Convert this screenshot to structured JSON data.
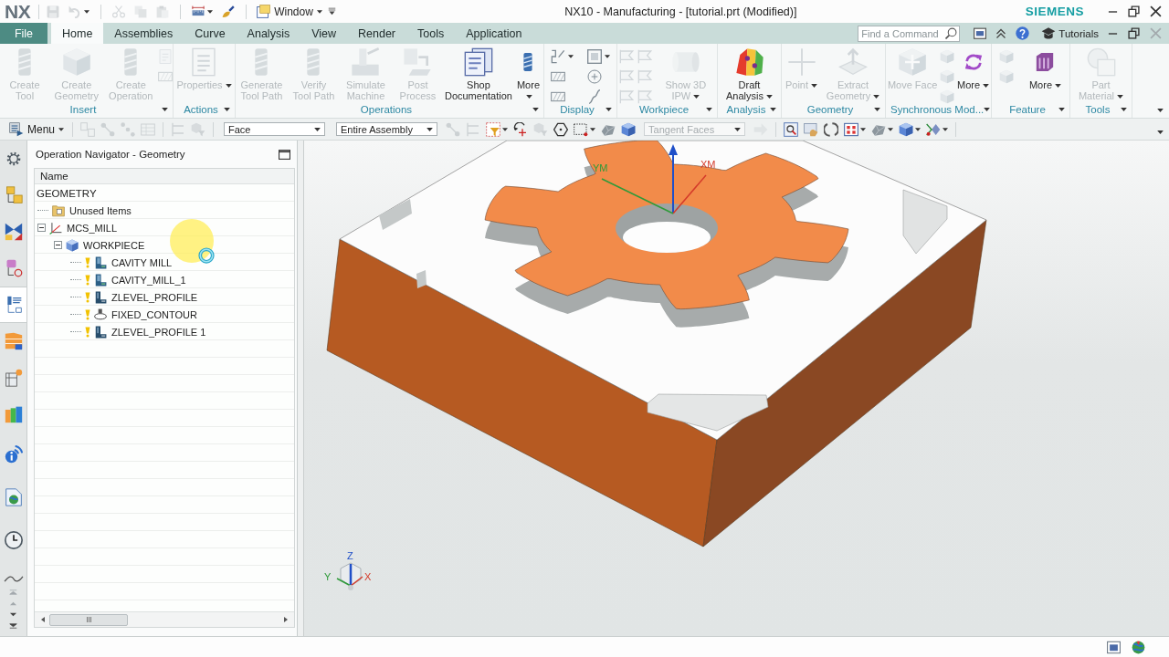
{
  "title_bar": {
    "logo": "NX",
    "quick_access": [
      {
        "disabled": true,
        "dropdown": false
      },
      {
        "disabled": true,
        "dropdown": true
      },
      {
        "disabled": true,
        "dropdown": false
      },
      {
        "disabled": true,
        "dropdown": false
      },
      {
        "disabled": true,
        "dropdown": false
      },
      {
        "disabled": false,
        "dropdown": true
      },
      {
        "disabled": false,
        "dropdown": false
      }
    ],
    "window_menu": "Window",
    "title": "NX10 - Manufacturing - [tutorial.prt (Modified)]",
    "brand": "SIEMENS"
  },
  "ribbon": {
    "tabs": [
      {
        "label": "File",
        "kind": "file",
        "selected": false
      },
      {
        "label": "Home",
        "kind": "tab",
        "selected": true
      },
      {
        "label": "Assemblies",
        "kind": "tab",
        "selected": false
      },
      {
        "label": "Curve",
        "kind": "tab",
        "selected": false
      },
      {
        "label": "Analysis",
        "kind": "tab",
        "selected": false
      },
      {
        "label": "View",
        "kind": "tab",
        "selected": false
      },
      {
        "label": "Render",
        "kind": "tab",
        "selected": false
      },
      {
        "label": "Tools",
        "kind": "tab",
        "selected": false
      },
      {
        "label": "Application",
        "kind": "tab",
        "selected": false
      }
    ],
    "search": {
      "placeholder": "Find a Command"
    },
    "help_link": "Tutorials",
    "groups": [
      {
        "label": "Insert",
        "commands": [
          {
            "kind": "large",
            "label": "Create Tool",
            "disabled": true,
            "dropdown": false
          },
          {
            "kind": "large",
            "label": "Create Geometry",
            "disabled": true,
            "dropdown": false
          },
          {
            "kind": "large",
            "label": "Create Operation",
            "disabled": true,
            "dropdown": false
          },
          {
            "kind": "stack",
            "items": [
              {
                "disabled": true,
                "dropdown": false
              },
              {
                "disabled": true,
                "dropdown": false
              }
            ]
          }
        ]
      },
      {
        "label": "Actions",
        "commands": [
          {
            "kind": "large",
            "label": "Properties",
            "disabled": true,
            "dropdown": true
          }
        ]
      },
      {
        "label": "Operations",
        "commands": [
          {
            "kind": "large",
            "label": "Generate Tool Path",
            "disabled": true,
            "dropdown": false
          },
          {
            "kind": "large",
            "label": "Verify Tool Path",
            "disabled": true,
            "dropdown": false
          },
          {
            "kind": "large",
            "label": "Simulate Machine",
            "disabled": true,
            "dropdown": false
          },
          {
            "kind": "large",
            "label": "Post Process",
            "disabled": true,
            "dropdown": false
          },
          {
            "kind": "large",
            "label": "Shop Documentation",
            "disabled": false,
            "dropdown": false
          },
          {
            "kind": "more",
            "label": "More",
            "disabled": false,
            "dropdown": true
          }
        ]
      },
      {
        "label": "Display",
        "commands": [
          {
            "kind": "stack",
            "items": [
              {
                "disabled": false,
                "dropdown": true
              },
              {
                "disabled": false,
                "dropdown": false
              },
              {
                "disabled": false,
                "dropdown": false
              }
            ]
          },
          {
            "kind": "stack",
            "items": [
              {
                "disabled": false,
                "dropdown": true
              },
              {
                "disabled": false,
                "dropdown": false
              },
              {
                "disabled": false,
                "dropdown": false
              }
            ]
          }
        ]
      },
      {
        "label": "Workpiece",
        "commands": [
          {
            "kind": "stack",
            "items": [
              {
                "disabled": true,
                "dropdown": false
              },
              {
                "disabled": true,
                "dropdown": false
              },
              {
                "disabled": true,
                "dropdown": false
              }
            ]
          },
          {
            "kind": "stack",
            "items": [
              {
                "disabled": true,
                "dropdown": false
              },
              {
                "disabled": true,
                "dropdown": false
              },
              {
                "disabled": true,
                "dropdown": false
              }
            ]
          },
          {
            "kind": "large",
            "label": "Show 3D IPW",
            "disabled": true,
            "dropdown": true
          }
        ]
      },
      {
        "label": "Analysis",
        "commands": [
          {
            "kind": "large",
            "label": "Draft Analysis",
            "disabled": false,
            "dropdown": true
          }
        ]
      },
      {
        "label": "Geometry",
        "commands": [
          {
            "kind": "large",
            "label": "Point",
            "disabled": true,
            "dropdown": true
          },
          {
            "kind": "large",
            "label": "Extract Geometry",
            "disabled": true,
            "dropdown": true
          }
        ]
      },
      {
        "label": "Synchronous Mod...",
        "commands": [
          {
            "kind": "large",
            "label": "Move Face",
            "disabled": true,
            "dropdown": false
          },
          {
            "kind": "stack",
            "items": [
              {
                "disabled": true,
                "dropdown": false
              },
              {
                "disabled": true,
                "dropdown": false
              },
              {
                "disabled": true,
                "dropdown": false
              }
            ]
          },
          {
            "kind": "more",
            "label": "More",
            "disabled": false,
            "dropdown": true
          }
        ]
      },
      {
        "label": "Feature",
        "commands": [
          {
            "kind": "stack",
            "items": [
              {
                "disabled": true,
                "dropdown": false
              },
              {
                "disabled": true,
                "dropdown": false
              }
            ]
          },
          {
            "kind": "more",
            "label": "More",
            "disabled": false,
            "dropdown": true
          }
        ]
      },
      {
        "label": "Tools",
        "commands": [
          {
            "kind": "large",
            "label": "Part Material",
            "disabled": true,
            "dropdown": true
          }
        ]
      }
    ]
  },
  "selection_bar": {
    "menu": "Menu",
    "groups": [
      [
        {
          "kind": "icon",
          "disabled": true,
          "dropdown": false
        },
        {
          "kind": "icon",
          "disabled": true,
          "dropdown": false
        },
        {
          "kind": "icon",
          "disabled": true,
          "dropdown": false
        },
        {
          "kind": "icon",
          "disabled": true,
          "dropdown": false
        }
      ],
      [
        {
          "kind": "icon",
          "disabled": true,
          "dropdown": false
        },
        {
          "kind": "icon",
          "disabled": true,
          "dropdown": false
        }
      ],
      [
        {
          "kind": "filter",
          "value": "Face",
          "disabled": false,
          "dropdown": true
        },
        {
          "kind": "filter",
          "value": "Entire Assembly",
          "disabled": false,
          "dropdown": true
        },
        {
          "kind": "icon",
          "disabled": true,
          "dropdown": false
        },
        {
          "kind": "icon",
          "disabled": true,
          "dropdown": false
        },
        {
          "kind": "icon",
          "disabled": false,
          "dropdown": true
        },
        {
          "kind": "icon",
          "disabled": false,
          "dropdown": false
        },
        {
          "kind": "icon",
          "disabled": true,
          "dropdown": false
        },
        {
          "kind": "icon",
          "disabled": false,
          "dropdown": false
        },
        {
          "kind": "icon",
          "disabled": false,
          "dropdown": true
        },
        {
          "kind": "icon",
          "disabled": false,
          "dropdown": false
        },
        {
          "kind": "icon",
          "disabled": false,
          "dropdown": false
        },
        {
          "kind": "filter",
          "value": "Tangent Faces",
          "disabled": true,
          "dropdown": true
        },
        {
          "kind": "icon",
          "disabled": true,
          "dropdown": false
        }
      ],
      [
        {
          "kind": "icon",
          "disabled": false,
          "dropdown": false
        },
        {
          "kind": "icon",
          "disabled": false,
          "dropdown": false
        },
        {
          "kind": "icon",
          "disabled": false,
          "dropdown": false
        },
        {
          "kind": "icon",
          "disabled": false,
          "dropdown": true
        },
        {
          "kind": "icon",
          "disabled": false,
          "dropdown": true
        },
        {
          "kind": "icon",
          "disabled": false,
          "dropdown": true
        },
        {
          "kind": "icon",
          "disabled": false,
          "dropdown": true
        }
      ]
    ]
  },
  "resource_bar": [
    {
      "selected": false
    },
    {
      "selected": false
    },
    {
      "selected": false
    },
    {
      "selected": false
    },
    {
      "selected": true
    },
    {
      "selected": false
    },
    {
      "selected": false
    },
    {
      "selected": false
    },
    {
      "selected": false
    },
    {
      "selected": false
    },
    {
      "selected": false
    }
  ],
  "navigator": {
    "title": "Operation Navigator - Geometry",
    "columns": [
      "Name"
    ],
    "root": "GEOMETRY",
    "items": [
      {
        "name": "Unused Items",
        "kind": "folder"
      },
      {
        "name": "MCS_MILL",
        "kind": "mcs",
        "expanded": true,
        "children": [
          {
            "name": "WORKPIECE",
            "kind": "workpiece",
            "expanded": true,
            "children": [
              {
                "name": "CAVITY MILL",
                "kind": "cavity_mill",
                "needs_regenerate": true
              },
              {
                "name": "CAVITY_MILL_1",
                "kind": "cavity_mill",
                "needs_regenerate": true
              },
              {
                "name": "ZLEVEL_PROFILE",
                "kind": "zlevel_profile",
                "needs_regenerate": true
              },
              {
                "name": "FIXED_CONTOUR",
                "kind": "fixed_contour",
                "needs_regenerate": true
              },
              {
                "name": "ZLEVEL_PROFILE 1",
                "kind": "zlevel_profile",
                "needs_regenerate": true
              }
            ]
          }
        ]
      }
    ]
  },
  "viewport": {
    "wcs": {
      "x_label": "XM",
      "y_label": "YM"
    },
    "view_triad": {
      "x_label": "X",
      "y_label": "Y",
      "z_label": "Z"
    }
  }
}
